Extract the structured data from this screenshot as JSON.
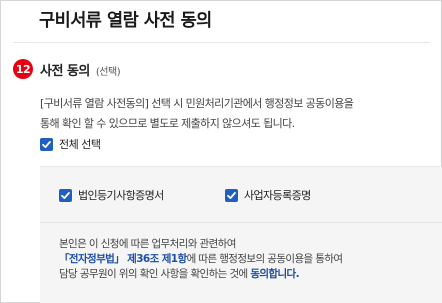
{
  "page": {
    "title": "구비서류 열람 사전 동의"
  },
  "section": {
    "number": "12",
    "title": "사전 동의",
    "optional_label": "(선택)",
    "description_line1": "[구비서류 열람 사전동의] 선택 시 민원처리기관에서 행정정보 공동이용을",
    "description_line2": "통해 확인 할 수 있으므로 별도로 제출하지 않으셔도 됩니다."
  },
  "select_all": {
    "label": "전체 선택",
    "checked": true
  },
  "documents": [
    {
      "label": "법인등기사항증명서",
      "checked": true
    },
    {
      "label": "사업자등록증명",
      "checked": true
    }
  ],
  "agreement": {
    "line1": "본인은 이 신청에 따른 업무처리와 관련하여",
    "law_name": "「전자정부법」 제36조 제1항",
    "line2_rest": "에 따른 행정정보의 공동이용을 통하여",
    "line3_start": "담당 공무원이 위의 확인 사항을 확인하는 것에 ",
    "line3_emphasis": "동의합니다."
  },
  "colors": {
    "accent": "#1f5fbf",
    "badge": "#e60012",
    "link": "#1f4ea8"
  }
}
